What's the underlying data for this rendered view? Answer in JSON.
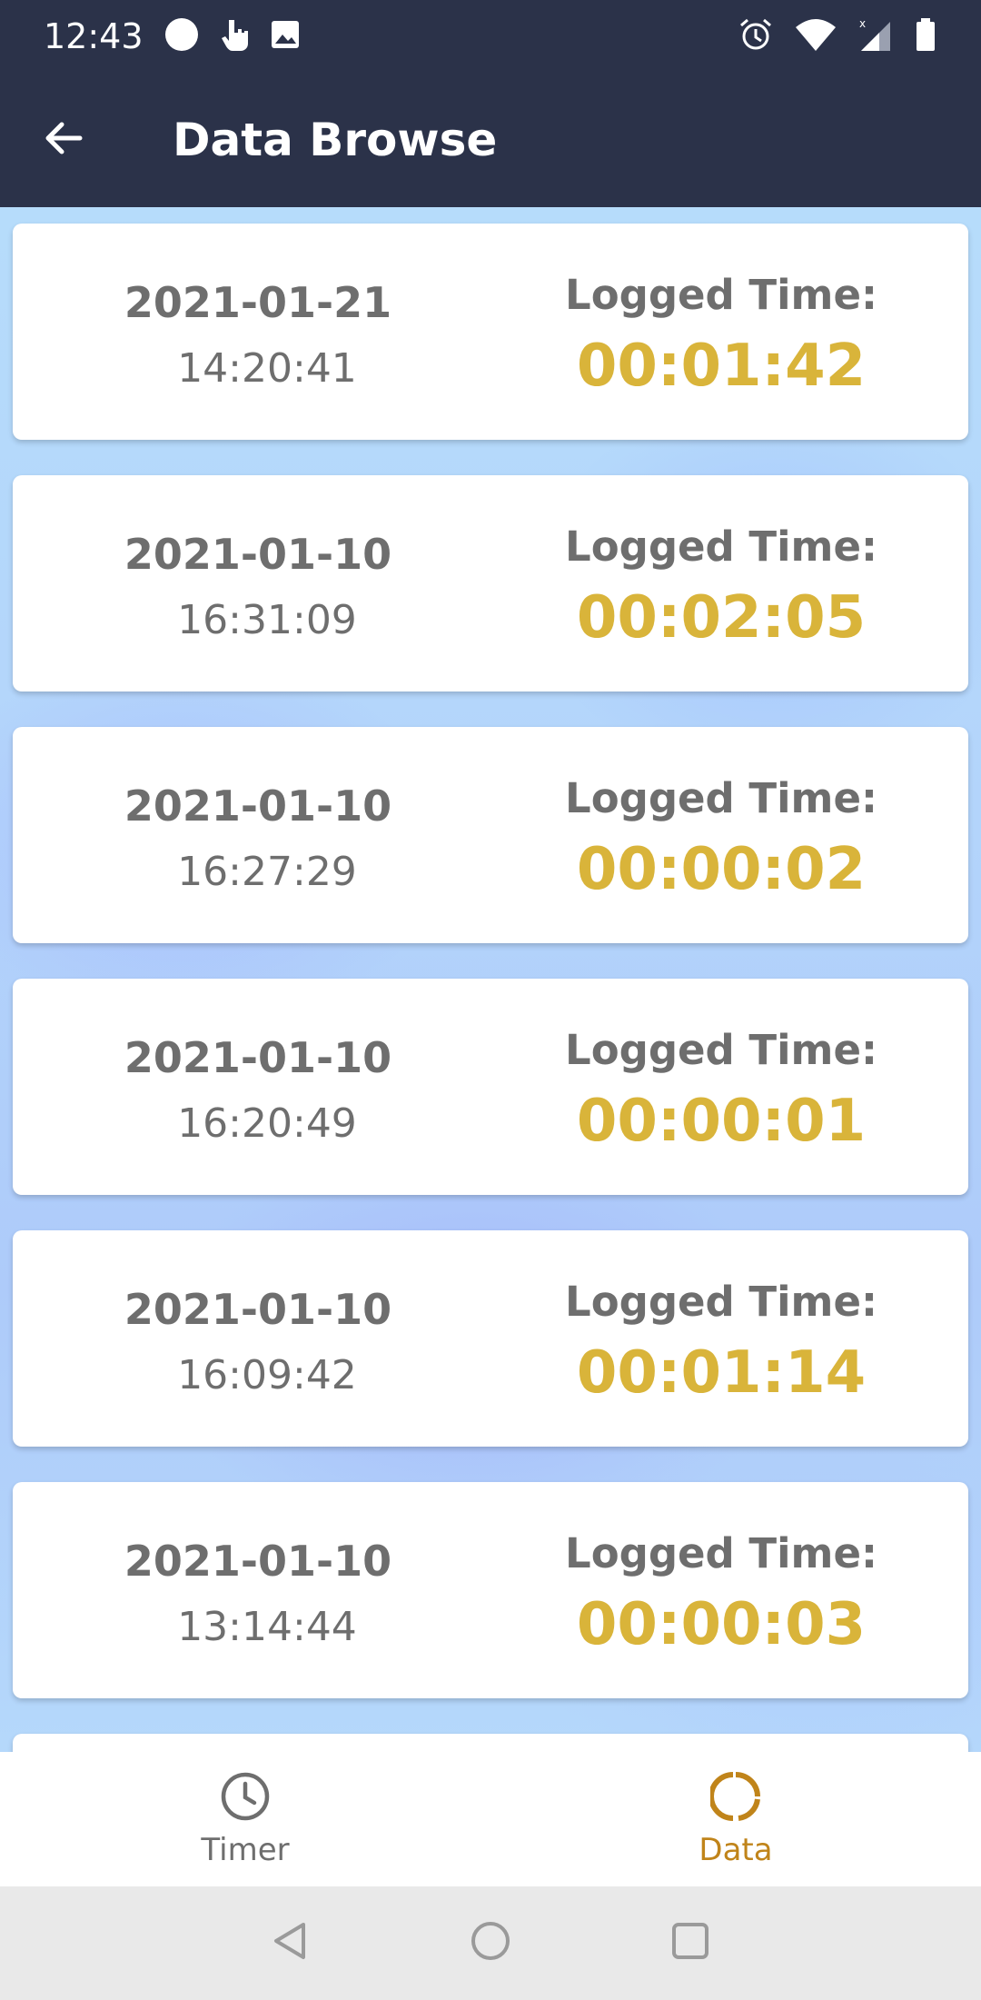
{
  "status_bar": {
    "time": "12:43",
    "icons_left": [
      "circle-icon",
      "touch-icon",
      "image-icon"
    ],
    "icons_right": [
      "alarm-icon",
      "wifi-icon",
      "signal-icon",
      "battery-icon"
    ]
  },
  "app_bar": {
    "title": "Data Browse",
    "back_icon": "arrow-left-icon"
  },
  "records": [
    {
      "date": "2021-01-21",
      "time": "14:20:41",
      "logged_label": "Logged Time:",
      "logged_value": "00:01:42"
    },
    {
      "date": "2021-01-10",
      "time": "16:31:09",
      "logged_label": "Logged Time:",
      "logged_value": "00:02:05"
    },
    {
      "date": "2021-01-10",
      "time": "16:27:29",
      "logged_label": "Logged Time:",
      "logged_value": "00:00:02"
    },
    {
      "date": "2021-01-10",
      "time": "16:20:49",
      "logged_label": "Logged Time:",
      "logged_value": "00:00:01"
    },
    {
      "date": "2021-01-10",
      "time": "16:09:42",
      "logged_label": "Logged Time:",
      "logged_value": "00:01:14"
    },
    {
      "date": "2021-01-10",
      "time": "13:14:44",
      "logged_label": "Logged Time:",
      "logged_value": "00:00:03"
    }
  ],
  "bottom_nav": {
    "items": [
      {
        "label": "Timer",
        "icon": "clock-icon",
        "active": false
      },
      {
        "label": "Data",
        "icon": "donut-chart-icon",
        "active": true
      }
    ]
  },
  "colors": {
    "app_bar": "#2b3249",
    "accent_gold": "#d9b43a",
    "active_nav": "#c0841a",
    "text_gray": "#6e6e6e"
  }
}
